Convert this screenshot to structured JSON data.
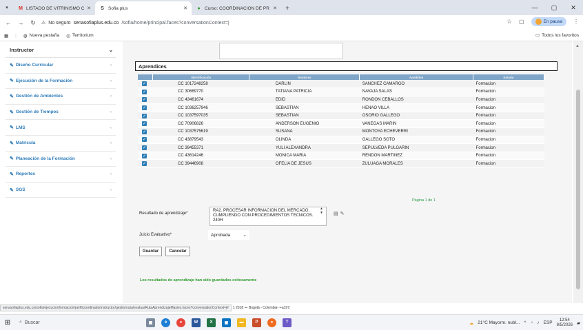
{
  "browser": {
    "tabs": [
      {
        "icon": "gmail-icon",
        "title": "LISTADO DE VITRINISMO CON",
        "color": "#d93025",
        "active": false
      },
      {
        "icon": "sofia-icon",
        "title": "Sofia plus",
        "color": "#333333",
        "active": true
      },
      {
        "icon": "course-icon",
        "title": "Curso: COORDINACION DE PR",
        "color": "#2e9b2e",
        "active": false
      }
    ],
    "new_tab": "+",
    "security_label": "No seguro",
    "url_domain": "senasofiaplus.edu.co",
    "url_path": "/sofia/home/principal.faces?conversationContext=j",
    "pause_label": "En pausa",
    "bookmarks": [
      {
        "icon": "apps-icon",
        "label": ""
      },
      {
        "icon": "newtab-icon",
        "label": "Nueva pestaña"
      },
      {
        "icon": "globe-icon",
        "label": "Territorium"
      }
    ],
    "all_bookmarks": "Todos los favoritos"
  },
  "sidebar": {
    "role": "Instructor",
    "items": [
      {
        "label": "Diseño Curricular"
      },
      {
        "label": "Ejecución de la Formación"
      },
      {
        "label": "Gestión de Ambientes"
      },
      {
        "label": "Gestión de Tiempos"
      },
      {
        "label": "LMS"
      },
      {
        "label": "Matrícula"
      },
      {
        "label": "Planeación de la Formación"
      },
      {
        "label": "Reportes"
      },
      {
        "label": "SGS"
      }
    ]
  },
  "main": {
    "section_title": "Aprendices",
    "columns": [
      "Identificación",
      "Nombres",
      "Apellidos",
      "Estado"
    ],
    "rows": [
      {
        "id": "CC 1017248258",
        "nombres": "DARLIN",
        "apellidos": "SANCHEZ CAMARGO",
        "estado": "Formacion"
      },
      {
        "id": "CC 30669770",
        "nombres": "TATIANA PATRICIA",
        "apellidos": "NAVAJA SALAS",
        "estado": "Formacion"
      },
      {
        "id": "CC 43461674",
        "nombres": "EDID",
        "apellidos": "RONDON CEBALLOS",
        "estado": "Formacion"
      },
      {
        "id": "CC 1036257946",
        "nombres": "SEBASTIAN",
        "apellidos": "HENAO VILLA",
        "estado": "Formacion"
      },
      {
        "id": "CC 1037597035",
        "nombres": "SEBASTIAN",
        "apellidos": "OSORIO GALLEGO",
        "estado": "Formacion"
      },
      {
        "id": "CC 70906826",
        "nombres": "ANDERSON EUGENIO",
        "apellidos": "VANEGAS MARIN",
        "estado": "Formacion"
      },
      {
        "id": "CC 1037575619",
        "nombres": "SUSANA",
        "apellidos": "MONTOYA ECHEVERRI",
        "estado": "Formacion"
      },
      {
        "id": "CC 43879543",
        "nombres": "OLINDA",
        "apellidos": "GALLEGO SOTO",
        "estado": "Formacion"
      },
      {
        "id": "CC 39455371",
        "nombres": "YULI ALEXANDRA",
        "apellidos": "SEPULVEDA PULGARIN",
        "estado": "Formacion"
      },
      {
        "id": "CC 43614246",
        "nombres": "MONICA MARIA",
        "apellidos": "RENDON MARTINEZ",
        "estado": "Formacion"
      },
      {
        "id": "CC 39446908",
        "nombres": "OFELIA DE JESUS",
        "apellidos": "ZULUAGA MORALES",
        "estado": "Formacion"
      }
    ],
    "pager": "Página 1 de 1",
    "resultado_label": "Resultado de aprendizaje*",
    "resultado_value": "RA2. PROCESAR INFORMACION DEL MERCADO, CUMPLIENDO CON PROCEDIMIENTOS TECNICOS. 240H",
    "juicio_label": "Juicio Evaluativo*",
    "juicio_value": "Aprobada",
    "save_label": "Guardar",
    "cancel_label": "Cancelar",
    "success_message": "Los resultados de aprendizaje han sido guardados exitosamente"
  },
  "status": {
    "url": "senasofiaplus.edu.co/sofia/ejecucionformacion/perfilcoordinadorinstructor/gestionruta/evaluarRutaAprendizajeMasivo.faces?conversationContext=j#",
    "footer": "1 2018 -•- Bogotá - Colombia- •-a197;"
  },
  "taskbar": {
    "search_placeholder": "Buscar",
    "weather": "21°C  Mayorm. nubl...",
    "lang": "ESP",
    "time": "12:54",
    "date": "8/5/2026"
  }
}
